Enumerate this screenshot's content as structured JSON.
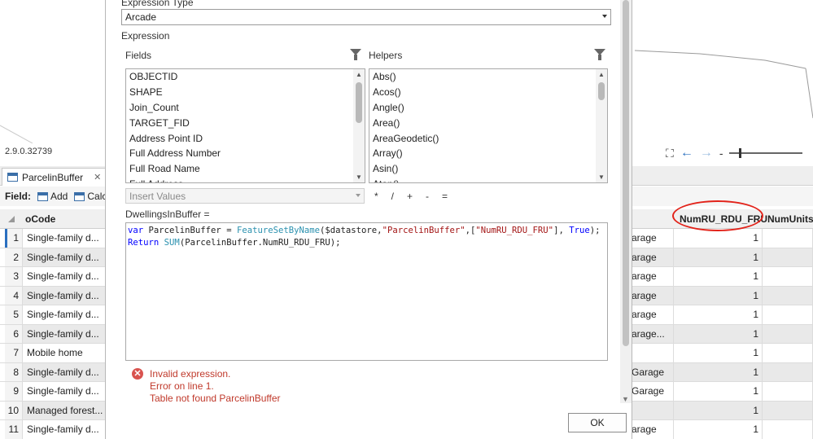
{
  "app": {
    "version": "2.9.0.32739"
  },
  "table_tab": {
    "label": "ParcelinBuffer"
  },
  "field_bar": {
    "label": "Field:",
    "add_label": "Add",
    "calc_label": "Calc"
  },
  "table": {
    "code_header": "oCode",
    "num_header": "NumRU_RDU_FRU",
    "num2_header": "NumUnits_",
    "rows": [
      {
        "n": "1",
        "code": "Single-family d...",
        "garage": "arage",
        "num": "1"
      },
      {
        "n": "2",
        "code": "Single-family d...",
        "garage": "arage",
        "num": "1"
      },
      {
        "n": "3",
        "code": "Single-family d...",
        "garage": "arage",
        "num": "1"
      },
      {
        "n": "4",
        "code": "Single-family d...",
        "garage": "arage",
        "num": "1"
      },
      {
        "n": "5",
        "code": "Single-family d...",
        "garage": "arage",
        "num": "1"
      },
      {
        "n": "6",
        "code": "Single-family d...",
        "garage": "arage...",
        "num": "1"
      },
      {
        "n": "7",
        "code": "Mobile home",
        "garage": "",
        "num": "1"
      },
      {
        "n": "8",
        "code": "Single-family d...",
        "garage": "Garage",
        "num": "1"
      },
      {
        "n": "9",
        "code": "Single-family d...",
        "garage": "Garage",
        "num": "1"
      },
      {
        "n": "10",
        "code": "Managed forest...",
        "garage": "",
        "num": "1"
      },
      {
        "n": "11",
        "code": "Single-family d...",
        "garage": "arage",
        "num": "1"
      }
    ]
  },
  "dialog": {
    "expression_type_label": "Expression Type",
    "expression_type_value": "Arcade",
    "expression_label": "Expression",
    "fields_label": "Fields",
    "helpers_label": "Helpers",
    "fields": [
      "OBJECTID",
      "SHAPE",
      "Join_Count",
      "TARGET_FID",
      "Address Point ID",
      "Full Address Number",
      "Full Road Name",
      "Full Address"
    ],
    "helpers": [
      "Abs()",
      "Acos()",
      "Angle()",
      "Area()",
      "AreaGeodetic()",
      "Array()",
      "Asin()",
      "Atan()"
    ],
    "insert_values_placeholder": "Insert Values",
    "operators": [
      "*",
      "/",
      "+",
      "-",
      "="
    ],
    "target_field": "DwellingsInBuffer =",
    "code": {
      "line1": {
        "kw1": "var",
        "p1": " ParcelinBuffer = ",
        "fn1": "FeatureSetByName",
        "p2": "($datastore,",
        "s1": "\"ParcelinBuffer\"",
        "p3": ",[",
        "s2": "\"NumRU_RDU_FRU\"",
        "p4": "], ",
        "kw2": "True",
        "p5": ");"
      },
      "line2": {
        "kw1": "Return",
        "p1": " ",
        "fn1": "SUM",
        "p2": "(ParcelinBuffer.NumRU_RDU_FRU);"
      }
    },
    "errors": [
      "Invalid expression.",
      "Error on line 1.",
      "Table not found ParcelinBuffer"
    ],
    "ok_label": "OK"
  },
  "colors": {
    "error": "#c0392b",
    "keyword": "#0000ff",
    "function": "#2b91af",
    "string": "#a31515",
    "annotation": "#e2231a"
  },
  "icons": [
    "funnel-icon",
    "error-icon",
    "table-icon",
    "back-arrow-icon",
    "forward-arrow-icon",
    "fit-extent-icon"
  ]
}
